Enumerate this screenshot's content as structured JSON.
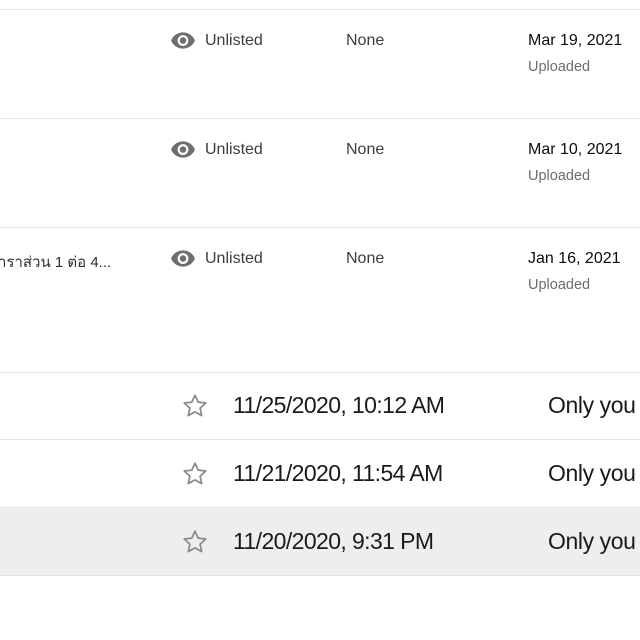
{
  "videos": [
    {
      "title": "",
      "visibility": "Unlisted",
      "restrictions": "None",
      "date": "Mar 19, 2021",
      "date_note": "Uploaded",
      "visibility_icon": "eye-icon"
    },
    {
      "title": "",
      "visibility": "Unlisted",
      "restrictions": "None",
      "date": "Mar 10, 2021",
      "date_note": "Uploaded",
      "visibility_icon": "eye-icon"
    },
    {
      "title": "าราส่วน 1 ต่อ 4...",
      "visibility": "Unlisted",
      "restrictions": "None",
      "date": "Jan 16, 2021",
      "date_note": "Uploaded",
      "visibility_icon": "eye-icon"
    }
  ],
  "files": [
    {
      "modified": "11/25/2020, 10:12 AM",
      "owner": "Only you",
      "starred": false,
      "selected": false
    },
    {
      "modified": "11/21/2020, 11:54 AM",
      "owner": "Only you",
      "starred": false,
      "selected": false
    },
    {
      "modified": "11/20/2020, 9:31 PM",
      "owner": "Only you",
      "starred": false,
      "selected": true
    }
  ],
  "colors": {
    "icon_gray": "#6e6e6e",
    "star_gray": "#8a8a8a",
    "selected_row": "#eeeeee"
  }
}
